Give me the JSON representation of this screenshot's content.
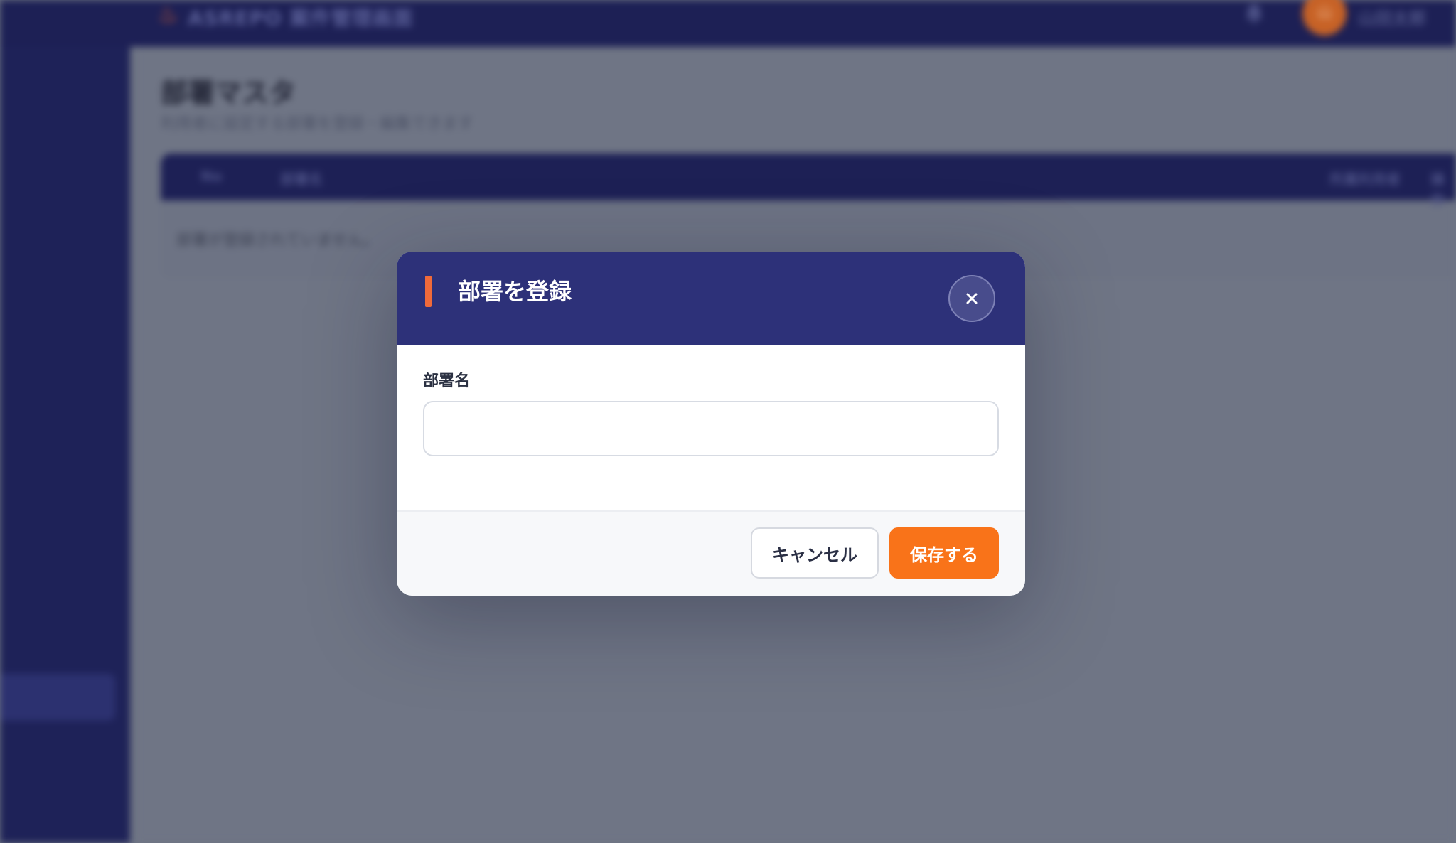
{
  "app": {
    "logo_text": "ASREPO 案件管理画面",
    "user_name": "山田太郎",
    "avatar_initial": "山"
  },
  "page": {
    "title": "部署マスタ",
    "subtitle": "利用者に設定する部署を登録・編集できます"
  },
  "table": {
    "columns": [
      "No",
      "部署名",
      "所属利用者",
      "操作"
    ],
    "empty_message": "部署が登録されていません。"
  },
  "modal": {
    "title": "部署を登録",
    "close_icon": "close-icon",
    "field_label": "部署名",
    "field_value": "",
    "field_placeholder": "",
    "cancel_label": "キャンセル",
    "save_label": "保存する"
  },
  "colors": {
    "header_bg": "#2d3179",
    "accent": "#f06a3a",
    "primary_button": "#f97319",
    "sidebar_bg": "#1e2258"
  }
}
